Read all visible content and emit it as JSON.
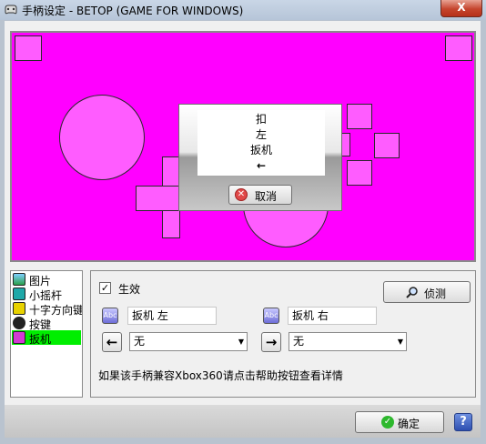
{
  "window": {
    "title": "手柄设定 - BETOP (GAME FOR WINDOWS)",
    "close_label": "X"
  },
  "popup": {
    "lines": [
      "扣",
      "左",
      "扳机",
      "←"
    ],
    "cancel_label": "取消"
  },
  "categories": [
    {
      "label": "图片",
      "icon": "picture-icon",
      "selected": false
    },
    {
      "label": "小摇杆",
      "icon": "joystick-icon",
      "selected": false
    },
    {
      "label": "十字方向键",
      "icon": "dpad-icon",
      "selected": false
    },
    {
      "label": "按键",
      "icon": "button-icon",
      "selected": false
    },
    {
      "label": "扳机",
      "icon": "trigger-icon",
      "selected": true
    }
  ],
  "settings": {
    "enabled_label": "生效",
    "enabled": true,
    "detect_label": "侦测",
    "left_trigger_value": "扳机 左",
    "right_trigger_value": "扳机 右",
    "left_select_value": "无",
    "right_select_value": "无",
    "hint": "如果该手柄兼容Xbox360请点击帮助按钮查看详情"
  },
  "footer": {
    "ok_label": "确定",
    "help_label": "?"
  },
  "colors": {
    "pad": "#ff00ff",
    "selected": "#00ee00"
  }
}
